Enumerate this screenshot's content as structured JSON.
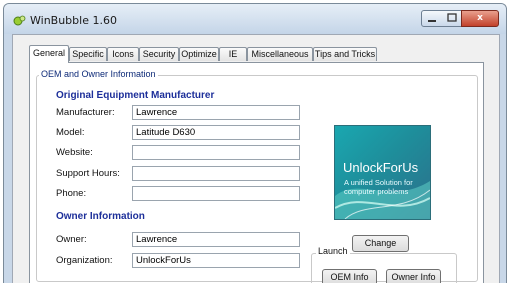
{
  "window": {
    "title": "WinBubble 1.60"
  },
  "tabs": [
    {
      "label": "General",
      "active": true
    },
    {
      "label": "Specific"
    },
    {
      "label": "Icons"
    },
    {
      "label": "Security"
    },
    {
      "label": "Optimize"
    },
    {
      "label": "IE"
    },
    {
      "label": "Miscellaneous"
    },
    {
      "label": "Tips and Tricks"
    }
  ],
  "panel": {
    "group_title": "OEM and Owner Information",
    "oem_heading": "Original Equipment Manufacturer",
    "fields": {
      "manufacturer": {
        "label": "Manufacturer:",
        "value": "Lawrence"
      },
      "model": {
        "label": "Model:",
        "value": "Latitude D630"
      },
      "website": {
        "label": "Website:",
        "value": ""
      },
      "support_hours": {
        "label": "Support Hours:",
        "value": ""
      },
      "phone": {
        "label": "Phone:",
        "value": ""
      }
    },
    "owner_heading": "Owner Information",
    "owner": {
      "label": "Owner:",
      "value": "Lawrence"
    },
    "organization": {
      "label": "Organization:",
      "value": "UnlockForUs"
    }
  },
  "logo": {
    "title": "UnlockForUs",
    "tagline": "A unified Solution for computer problems",
    "colors": {
      "primary": "#1aa7b0",
      "secondary": "#2c6f8b"
    }
  },
  "buttons": {
    "change": "Change",
    "launch_label": "Launch",
    "oem_info": "OEM Info",
    "owner_info": "Owner Info"
  },
  "titlebar_buttons": {
    "close": "x",
    "minimize": "minimize-icon",
    "maximize": "maximize-icon"
  }
}
